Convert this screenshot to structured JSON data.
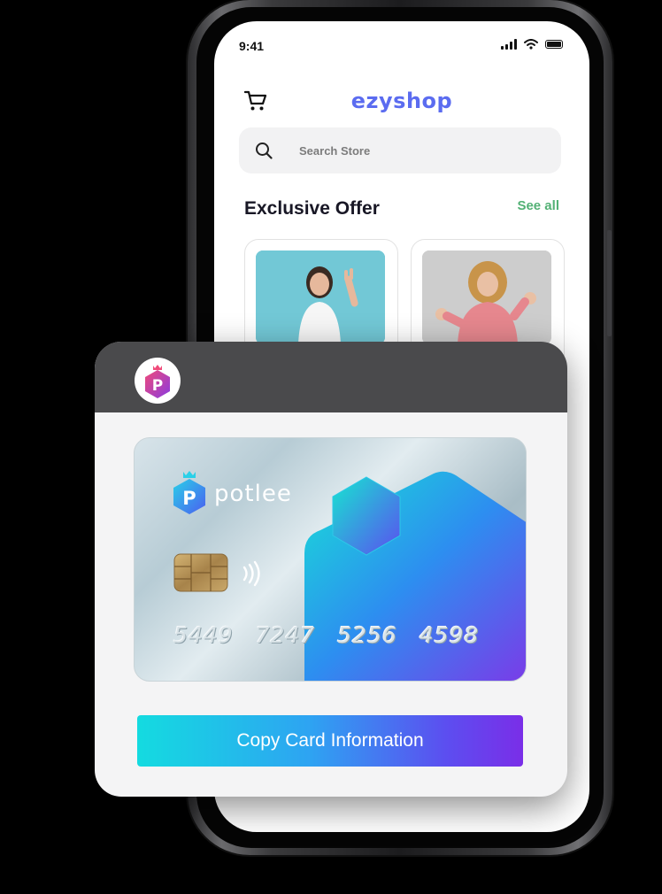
{
  "status_bar": {
    "time": "9:41",
    "icons": [
      "signal-icon",
      "wifi-icon",
      "battery-icon"
    ]
  },
  "app": {
    "brand": "ezyshop",
    "cart_icon": "cart-icon",
    "search": {
      "placeholder": "Search Store",
      "icon": "search-icon"
    },
    "section": {
      "title": "Exclusive Offer",
      "see_all": "See all"
    },
    "products": [
      {
        "image": "woman-white-tshirt-peace-sign-photo"
      },
      {
        "image": "woman-pink-hoodie-ok-sign-photo"
      }
    ]
  },
  "wallet_overlay": {
    "logo_icon": "potlee-logo-icon",
    "card": {
      "brand": "potlee",
      "number": "5449 7247 5256 4598",
      "chip_icon": "emv-chip-icon",
      "contactless_icon": "contactless-icon"
    },
    "copy_button": "Copy Card Information"
  },
  "colors": {
    "brand_blue": "#5b6cf0",
    "see_all_green": "#53b175",
    "button_gradient_start": "#14dbe0",
    "button_gradient_end": "#7a2ee8",
    "panel_header": "#4a4a4c"
  }
}
